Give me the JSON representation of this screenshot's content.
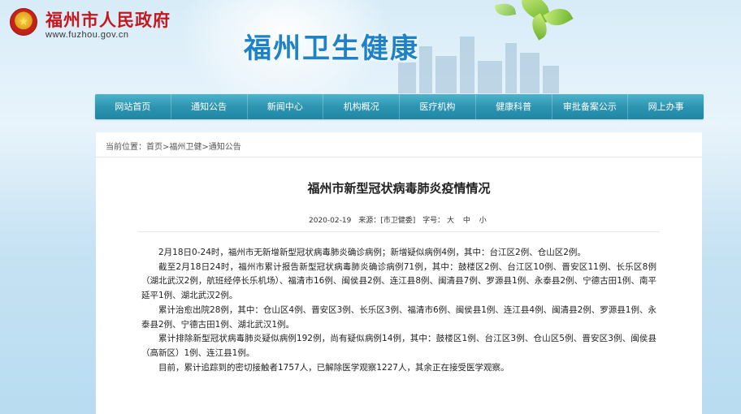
{
  "header": {
    "site_title": "福州市人民政府",
    "site_url": "www.fuzhou.gov.cn",
    "brand": "福州卫生健康"
  },
  "nav": {
    "items": [
      "网站首页",
      "通知公告",
      "新闻中心",
      "机构概况",
      "医疗机构",
      "健康科普",
      "审批备案公示",
      "网上办事"
    ]
  },
  "breadcrumb": {
    "prefix": "当前位置：",
    "home": "首页",
    "sep1": ">",
    "section": "福州卫健",
    "sep2": ">",
    "current": "通知公告"
  },
  "article": {
    "title": "福州市新型冠状病毒肺炎疫情情况",
    "date": "2020-02-19",
    "source_label": "来源：",
    "source": "[市卫健委]",
    "size_label": "字号：",
    "size_large": "大",
    "size_medium": "中",
    "size_small": "小",
    "paragraphs": [
      "2月18日0-24时，福州市无新增新型冠状病毒肺炎确诊病例；新增疑似病例4例，其中：台江区2例、仓山区2例。",
      "截至2月18日24时，福州市累计报告新型冠状病毒肺炎确诊病例71例，其中：鼓楼区2例、台江区10例、晋安区11例、长乐区8例（湖北武汉2例，航班经停长乐机场）、福清市16例、闽侯县2例、连江县8例、闽清县7例、罗源县1例、永泰县2例、宁德古田1例、南平延平1例、湖北武汉2例。",
      "累计治愈出院28例，其中：仓山区4例、晋安区3例、长乐区3例、福清市6例、闽侯县1例、连江县4例、闽清县2例、罗源县1例、永泰县2例、宁德古田1例、湖北武汉1例。",
      "累计排除新型冠状病毒肺炎疑似病例192例，尚有疑似病例14例，其中：鼓楼区1例、台江区3例、仓山区5例、晋安区3例、闽侯县（高新区）1例、连江县1例。",
      "目前，累计追踪到的密切接触者1757人，已解除医学观察1227人，其余正在接受医学观察。"
    ]
  },
  "colors": {
    "site_title": "#c7161d",
    "brand": "#1e82c8",
    "nav": "#2d95b1"
  },
  "icons": {
    "logo": "national-emblem-icon"
  }
}
